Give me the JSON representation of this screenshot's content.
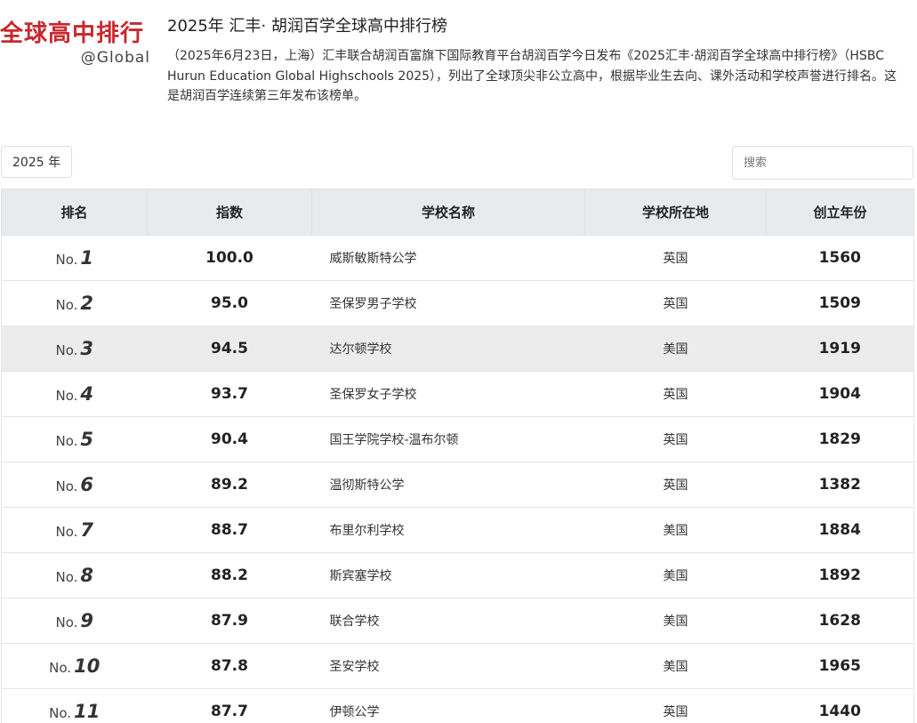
{
  "header": {
    "logo_main": "全球高中排行",
    "logo_sub": "@Global",
    "title": "2025年 汇丰· 胡润百学全球高中排行榜",
    "description": "（2025年6月23日，上海）汇丰联合胡润百富旗下国际教育平台胡润百学今日发布《2025汇丰·胡润百学全球高中排行榜》（HSBC Hurun Education Global Highschools 2025），列出了全球顶尖非公立高中，根据毕业生去向、课外活动和学校声誉进行排名。这是胡润百学连续第三年发布该榜单。"
  },
  "controls": {
    "year_label": "2025 年",
    "search_placeholder": "搜索"
  },
  "table": {
    "rank_prefix": "No.",
    "columns": [
      "排名",
      "指数",
      "学校名称",
      "学校所在地",
      "创立年份"
    ],
    "rows": [
      {
        "rank": "1",
        "index": "100.0",
        "name": "威斯敏斯特公学",
        "location": "英国",
        "founded": "1560"
      },
      {
        "rank": "2",
        "index": "95.0",
        "name": "圣保罗男子学校",
        "location": "英国",
        "founded": "1509"
      },
      {
        "rank": "3",
        "index": "94.5",
        "name": "达尔顿学校",
        "location": "美国",
        "founded": "1919"
      },
      {
        "rank": "4",
        "index": "93.7",
        "name": "圣保罗女子学校",
        "location": "英国",
        "founded": "1904"
      },
      {
        "rank": "5",
        "index": "90.4",
        "name": "国王学院学校-温布尔顿",
        "location": "英国",
        "founded": "1829"
      },
      {
        "rank": "6",
        "index": "89.2",
        "name": "温彻斯特公学",
        "location": "英国",
        "founded": "1382"
      },
      {
        "rank": "7",
        "index": "88.7",
        "name": "布里尔利学校",
        "location": "美国",
        "founded": "1884"
      },
      {
        "rank": "8",
        "index": "88.2",
        "name": "斯宾塞学校",
        "location": "美国",
        "founded": "1892"
      },
      {
        "rank": "9",
        "index": "87.9",
        "name": "联合学校",
        "location": "美国",
        "founded": "1628"
      },
      {
        "rank": "10",
        "index": "87.8",
        "name": "圣安学校",
        "location": "美国",
        "founded": "1965"
      },
      {
        "rank": "11",
        "index": "87.7",
        "name": "伊顿公学",
        "location": "英国",
        "founded": "1440"
      }
    ]
  },
  "colors": {
    "brand_red": "#c8282d",
    "header_bg": "#e8ebee",
    "highlight_row": "#ececec"
  }
}
